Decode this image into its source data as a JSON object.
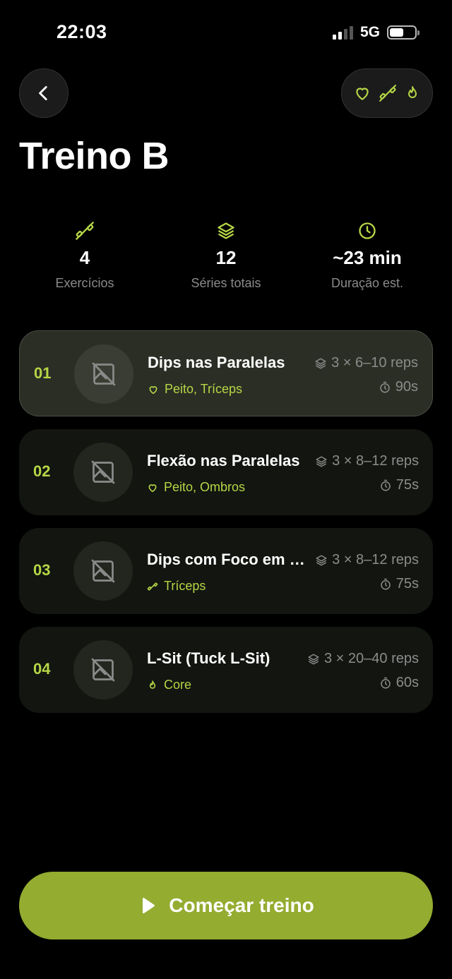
{
  "status_bar": {
    "time": "22:03",
    "network": "5G"
  },
  "header": {
    "title": "Treino B",
    "tag_icons": [
      "heart-icon",
      "dumbbell-icon",
      "flame-icon"
    ]
  },
  "stats": [
    {
      "icon": "dumbbell-icon",
      "value": "4",
      "label": "Exercícios"
    },
    {
      "icon": "layers-icon",
      "value": "12",
      "label": "Séries totais"
    },
    {
      "icon": "clock-icon",
      "value": "~23 min",
      "label": "Duração est."
    }
  ],
  "exercises": [
    {
      "number": "01",
      "name": "Dips nas Paralelas",
      "muscle": "Peito, Tríceps",
      "muscle_icon": "heart-icon",
      "sets": "3 × 6–10 reps",
      "rest": "90s",
      "active": true
    },
    {
      "number": "02",
      "name": "Flexão nas Paralelas",
      "muscle": "Peito, Ombros",
      "muscle_icon": "heart-icon",
      "sets": "3 × 8–12 reps",
      "rest": "75s",
      "active": false
    },
    {
      "number": "03",
      "name": "Dips com Foco em Tríceps",
      "muscle": "Tríceps",
      "muscle_icon": "dumbbell-icon",
      "sets": "3 × 8–12 reps",
      "rest": "75s",
      "active": false
    },
    {
      "number": "04",
      "name": "L-Sit (Tuck L-Sit)",
      "muscle": "Core",
      "muscle_icon": "flame-icon",
      "sets": "3 × 20–40 reps",
      "rest": "60s",
      "active": false
    }
  ],
  "start_button": {
    "label": "Começar treino"
  },
  "colors": {
    "accent": "#b6d646",
    "button": "#94ac30",
    "background": "#000000"
  }
}
